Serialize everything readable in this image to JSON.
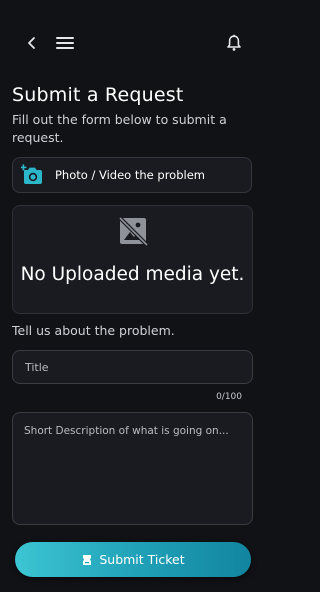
{
  "header": {
    "back_icon": "chevron-left-icon",
    "menu_icon": "hamburger-menu-icon",
    "notifications_icon": "bell-icon"
  },
  "page": {
    "title": "Submit a Request",
    "subtitle": "Fill out the form below to submit a request."
  },
  "media": {
    "upload_label": "Photo / Video the problem",
    "upload_icon": "add-camera-icon",
    "placeholder_icon": "image-not-supported-icon",
    "empty_text": "No Uploaded media yet."
  },
  "problem": {
    "section_label": "Tell us about the problem.",
    "title_placeholder": "Title",
    "title_value": "",
    "char_count": "0/100",
    "description_placeholder": "Short Description of what is going on...",
    "description_value": ""
  },
  "submit": {
    "label": "Submit Ticket",
    "icon": "ticket-icon"
  },
  "colors": {
    "background": "#111216",
    "card": "#1a1b20",
    "border": "#34363c",
    "accent": "#2bb7c9",
    "accent_dark": "#12859f"
  }
}
